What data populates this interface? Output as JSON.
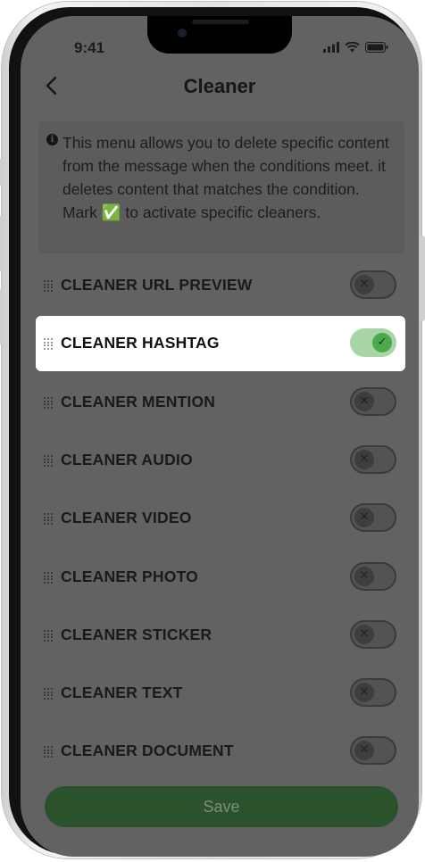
{
  "status_bar": {
    "time": "9:41"
  },
  "header": {
    "title": "Cleaner"
  },
  "info": {
    "text": "This menu allows you to delete specific content from the message when the conditions meet. it deletes content that matches the condition.\nMark ✅ to activate specific cleaners."
  },
  "cleaners": [
    {
      "label": "CLEANER URL PREVIEW",
      "enabled": false
    },
    {
      "label": "CLEANER HASHTAG",
      "enabled": true
    },
    {
      "label": "CLEANER MENTION",
      "enabled": false
    },
    {
      "label": "CLEANER AUDIO",
      "enabled": false
    },
    {
      "label": "CLEANER VIDEO",
      "enabled": false
    },
    {
      "label": "CLEANER PHOTO",
      "enabled": false
    },
    {
      "label": "CLEANER STICKER",
      "enabled": false
    },
    {
      "label": "CLEANER TEXT",
      "enabled": false
    },
    {
      "label": "CLEANER DOCUMENT",
      "enabled": false
    }
  ],
  "footer": {
    "save_label": "Save"
  },
  "colors": {
    "overlay": "#626262",
    "accent_green": "#4ea84c",
    "save_button": "#2c522c"
  }
}
